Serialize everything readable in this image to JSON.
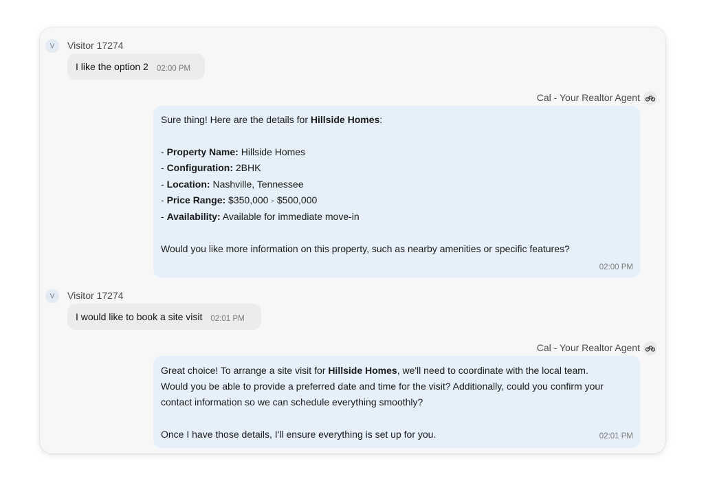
{
  "messages": [
    {
      "role": "visitor",
      "avatar": "V",
      "sender": "Visitor 17274",
      "text": "I like the option 2",
      "time": "02:00 PM"
    },
    {
      "role": "agent",
      "sender": "Cal - Your Realtor Agent",
      "icon": "bicycle-icon",
      "intro_pre": "Sure thing! Here are the details for ",
      "intro_bold": "Hillside Homes",
      "intro_post": ":",
      "details": [
        {
          "label": "Property Name:",
          "value": "Hillside Homes"
        },
        {
          "label": "Configuration:",
          "value": "2BHK"
        },
        {
          "label": "Location:",
          "value": "Nashville, Tennessee"
        },
        {
          "label": "Price Range:",
          "value": "$350,000 - $500,000"
        },
        {
          "label": "Availability:",
          "value": "Available for immediate move-in"
        }
      ],
      "question": "Would you like more information on this property, such as nearby amenities or specific features?",
      "time": "02:00 PM"
    },
    {
      "role": "visitor",
      "avatar": "V",
      "sender": "Visitor 17274",
      "text": "I would like to book a site visit",
      "time": "02:01 PM"
    },
    {
      "role": "agent",
      "sender": "Cal - Your Realtor Agent",
      "icon": "bicycle-icon",
      "p1_pre": "Great choice! To arrange a site visit for ",
      "p1_bold": "Hillside Homes",
      "p1_post": ", we'll need to coordinate with the local team.",
      "p1_line2": "Would you be able to provide a preferred date and time for the visit? Additionally, could you confirm your",
      "p1_line3": "contact information so we can schedule everything smoothly?",
      "p2": "Once I have those details, I'll ensure everything is set up for you.",
      "time": "02:01 PM"
    }
  ],
  "colors": {
    "visitor_bubble": "#ececee",
    "agent_bubble": "#e5f0fb",
    "window_bg": "#f7f7f8"
  }
}
